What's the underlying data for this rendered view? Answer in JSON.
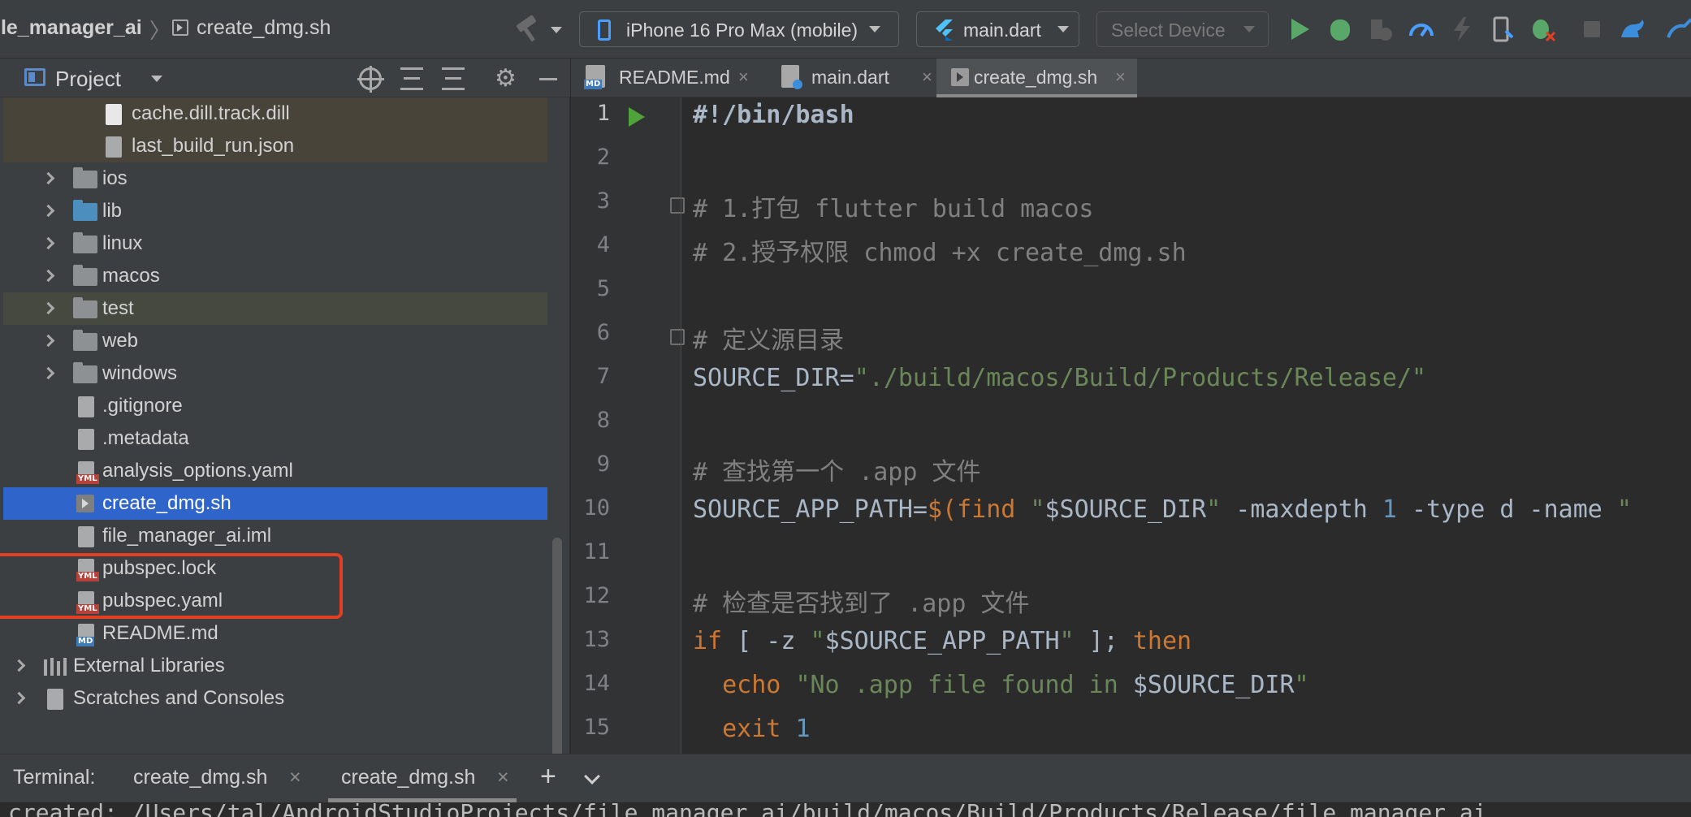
{
  "toolbar": {
    "breadcrumb_project": "ile_manager_ai",
    "breadcrumb_sep": "〉",
    "breadcrumb_file": "create_dmg.sh",
    "device": "iPhone 16 Pro Max (mobile)",
    "run_config": "main.dart",
    "select_device": "Select Device"
  },
  "project_panel": {
    "title": "Project",
    "tree": [
      {
        "label": "cache.dill.track.dill",
        "icon": "file-icon"
      },
      {
        "label": "last_build_run.json",
        "icon": "json-file-icon"
      },
      {
        "label": "ios",
        "icon": "folder-icon"
      },
      {
        "label": "lib",
        "icon": "folder-icon"
      },
      {
        "label": "linux",
        "icon": "folder-icon"
      },
      {
        "label": "macos",
        "icon": "folder-icon"
      },
      {
        "label": "test",
        "icon": "test-folder-icon"
      },
      {
        "label": "web",
        "icon": "web-folder-icon"
      },
      {
        "label": "windows",
        "icon": "folder-icon"
      },
      {
        "label": ".gitignore",
        "icon": "gitignore-file-icon"
      },
      {
        "label": ".metadata",
        "icon": "file-icon"
      },
      {
        "label": "analysis_options.yaml",
        "icon": "yaml-file-icon"
      },
      {
        "label": "create_dmg.sh",
        "icon": "shell-file-icon"
      },
      {
        "label": "file_manager_ai.iml",
        "icon": "iml-file-icon"
      },
      {
        "label": "pubspec.lock",
        "icon": "yaml-file-icon"
      },
      {
        "label": "pubspec.yaml",
        "icon": "yaml-file-icon"
      },
      {
        "label": "README.md",
        "icon": "markdown-file-icon"
      },
      {
        "label": "External Libraries",
        "icon": "library-icon"
      },
      {
        "label": "Scratches and Consoles",
        "icon": "scratches-icon"
      }
    ],
    "selected": "create_dmg.sh"
  },
  "tabs": [
    {
      "label": "README.md",
      "icon": "markdown-file-icon"
    },
    {
      "label": "main.dart",
      "icon": "dart-file-icon"
    },
    {
      "label": "create_dmg.sh",
      "icon": "shell-file-icon",
      "active": true
    }
  ],
  "editor": {
    "line_numbers": [
      "1",
      "2",
      "3",
      "4",
      "5",
      "6",
      "7",
      "8",
      "9",
      "10",
      "11",
      "12",
      "13",
      "14",
      "15"
    ],
    "lines": {
      "l1": "#!/bin/bash",
      "l3": "# 1.打包 flutter build macos",
      "l4": "# 2.授予权限 chmod +x create_dmg.sh",
      "l6": "# 定义源目录",
      "l7_var": "SOURCE_DIR=",
      "l7_str": "\"./build/macos/Build/Products/Release/\"",
      "l9": "# 查找第一个 .app 文件",
      "l10_a": "SOURCE_APP_PATH=",
      "l10_b": "$(find ",
      "l10_c": "\"",
      "l10_d": "$SOURCE_DIR",
      "l10_e": "\"",
      "l10_f": " -maxdepth ",
      "l10_g": "1",
      "l10_h": " -type d -name ",
      "l10_i": "\"",
      "l12": "# 检查是否找到了 .app 文件",
      "l13_a": "if",
      "l13_b": " [ -z ",
      "l13_c": "\"",
      "l13_d": "$SOURCE_APP_PATH",
      "l13_e": "\"",
      "l13_f": " ]; ",
      "l13_g": "then",
      "l14_a": "  echo ",
      "l14_b": "\"No .app file found in ",
      "l14_c": "$SOURCE_DIR",
      "l14_d": "\"",
      "l15_a": "  exit ",
      "l15_b": "1"
    }
  },
  "terminal": {
    "label": "Terminal:",
    "tabs": [
      "create_dmg.sh",
      "create_dmg.sh"
    ],
    "close": "×",
    "add": "+",
    "output_partial": "created: /Users/tal/AndroidStudioProjects/file_manager_ai/build/macos/Build/Products/Release/file_manager_ai"
  },
  "colors": {
    "selection": "#2f65ca",
    "annotation_box": "#e23f23",
    "run_green": "#59a869"
  }
}
